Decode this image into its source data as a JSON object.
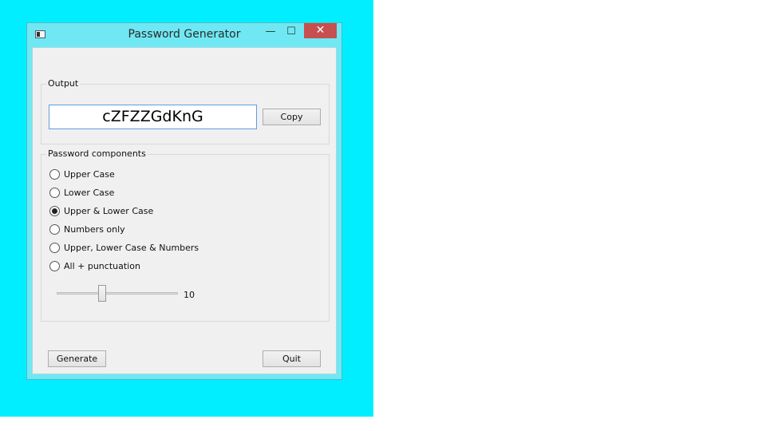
{
  "window": {
    "title": "Password Generator",
    "controls": {
      "minimize": "—",
      "maximize": "☐",
      "close": "✕"
    }
  },
  "output": {
    "group_label": "Output",
    "password": "cZFZZGdKnG",
    "copy_label": "Copy"
  },
  "components": {
    "group_label": "Password components",
    "options": [
      {
        "label": "Upper Case",
        "checked": false
      },
      {
        "label": "Lower Case",
        "checked": false
      },
      {
        "label": "Upper & Lower Case",
        "checked": true
      },
      {
        "label": "Numbers only",
        "checked": false
      },
      {
        "label": "Upper, Lower Case & Numbers",
        "checked": false
      },
      {
        "label": "All + punctuation",
        "checked": false
      }
    ],
    "length_value": "10"
  },
  "actions": {
    "generate_label": "Generate",
    "quit_label": "Quit"
  },
  "colors": {
    "desktop": "#00eeff",
    "title_bar": "#6fe8f4",
    "close_button": "#c74f4f",
    "client": "#f0f0f0",
    "field_border": "#5d9ee0"
  }
}
